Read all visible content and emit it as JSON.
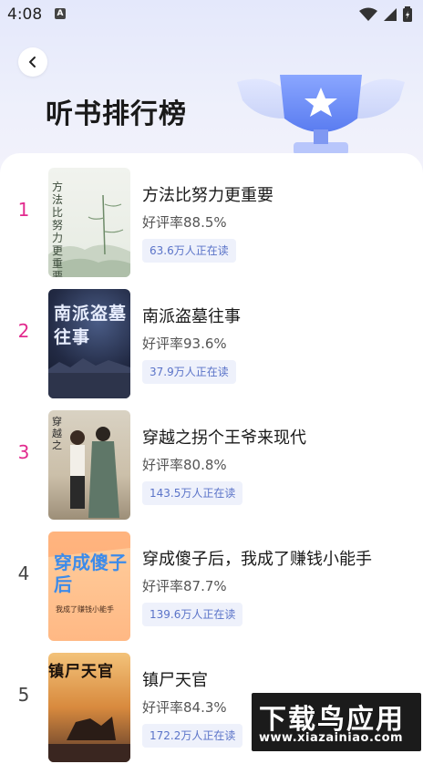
{
  "status": {
    "time": "4:08",
    "notif_badge": "A"
  },
  "header": {
    "title": "听书排行榜"
  },
  "books": [
    {
      "rank": "1",
      "title": "方法比努力更重要",
      "rating": "好评率88.5%",
      "readers": "63.6万人正在读",
      "cover_text": "方法比努力更重要",
      "top": true
    },
    {
      "rank": "2",
      "title": "南派盗墓往事",
      "rating": "好评率93.6%",
      "readers": "37.9万人正在读",
      "cover_text": "南派盗墓往事",
      "top": true
    },
    {
      "rank": "3",
      "title": "穿越之拐个王爷来现代",
      "rating": "好评率80.8%",
      "readers": "143.5万人正在读",
      "cover_text": "穿越之",
      "top": true
    },
    {
      "rank": "4",
      "title": "穿成傻子后，我成了赚钱小能手",
      "rating": "好评率87.7%",
      "readers": "139.6万人正在读",
      "cover_text": "穿成傻子后",
      "cover_sub": "我成了赚钱小能手",
      "top": false
    },
    {
      "rank": "5",
      "title": "镇尸天官",
      "rating": "好评率84.3%",
      "readers": "172.2万人正在读",
      "cover_text": "镇尸天官",
      "top": false
    }
  ],
  "watermark": {
    "main": "下载鸟应用",
    "sub": "www.xiazainiao.com"
  },
  "colors": {
    "top_rank": "#e22a8e",
    "badge_bg": "#eef1fb",
    "badge_text": "#5a73c8"
  }
}
